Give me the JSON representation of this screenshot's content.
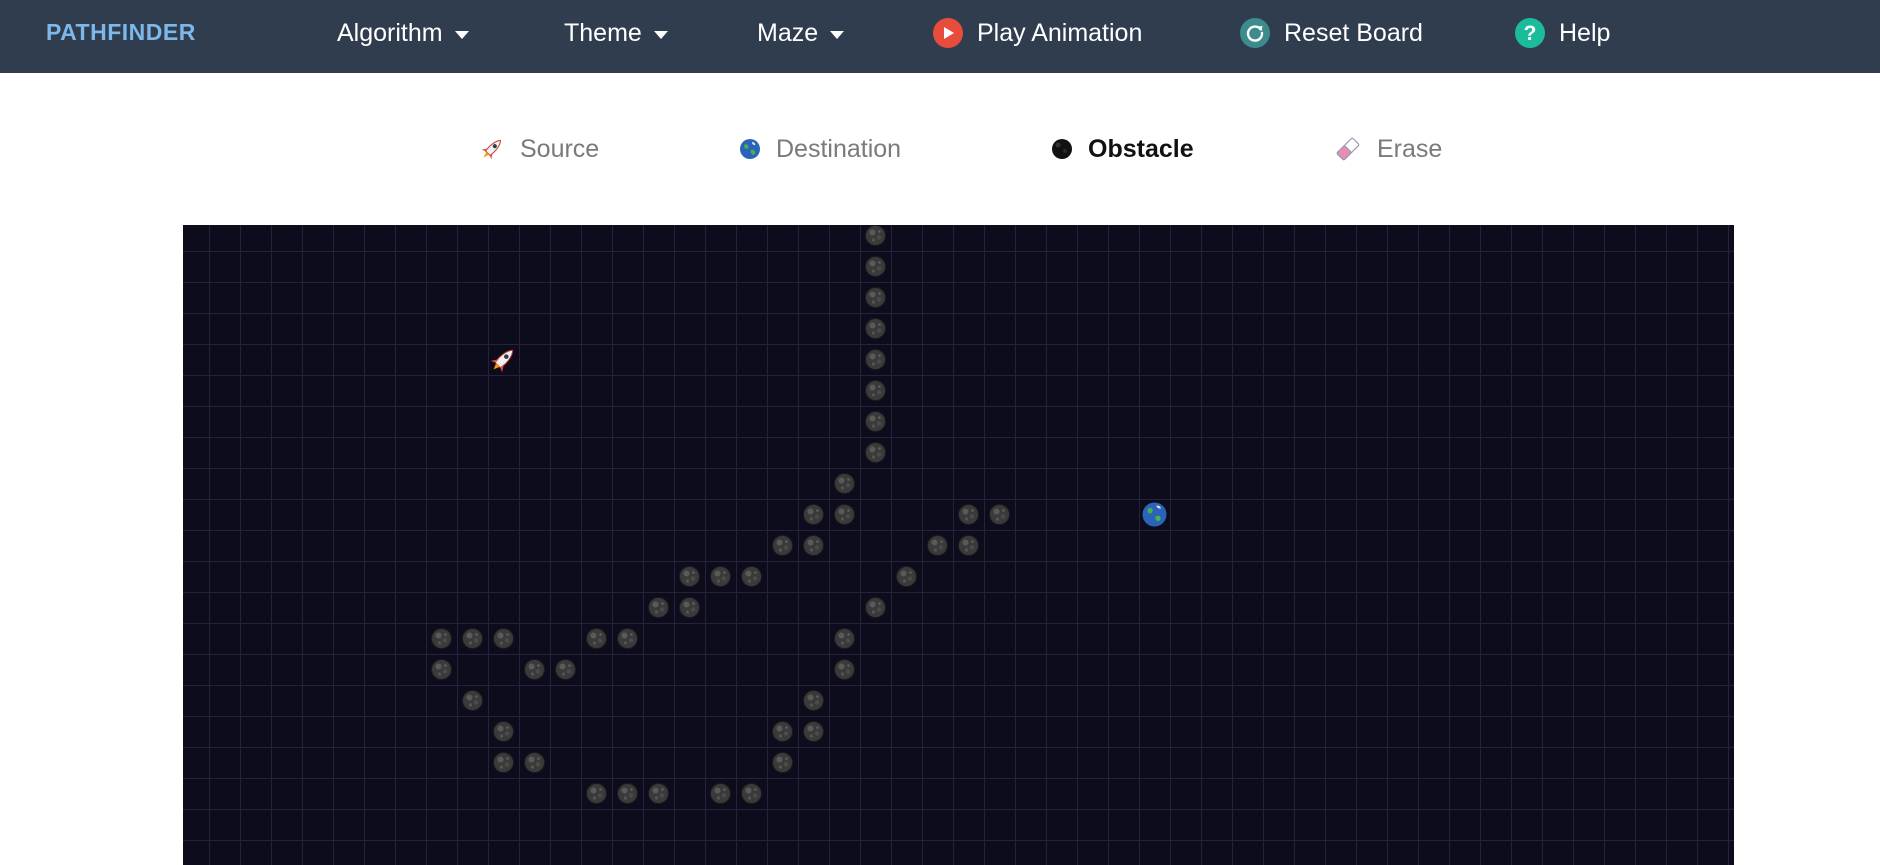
{
  "nav": {
    "brand": "PATHFINDER",
    "algorithm_label": "Algorithm",
    "theme_label": "Theme",
    "maze_label": "Maze",
    "play_label": "Play Animation",
    "reset_label": "Reset Board",
    "help_label": "Help",
    "colors": {
      "bar": "#2f3d4f",
      "brand": "#7eb7ea",
      "play": "#e74c3c",
      "reset": "#3d8b8d",
      "help": "#1abc9c"
    }
  },
  "toolbar": {
    "source_label": "Source",
    "destination_label": "Destination",
    "obstacle_label": "Obstacle",
    "erase_label": "Erase",
    "active_tool": "Obstacle"
  },
  "board": {
    "cols": 50,
    "rows": 20,
    "source": {
      "row": 4,
      "col": 10
    },
    "destination": {
      "row": 9,
      "col": 31
    },
    "obstacles": [
      [
        0,
        22
      ],
      [
        1,
        22
      ],
      [
        2,
        22
      ],
      [
        3,
        22
      ],
      [
        4,
        22
      ],
      [
        5,
        22
      ],
      [
        6,
        22
      ],
      [
        7,
        22
      ],
      [
        8,
        21
      ],
      [
        9,
        20
      ],
      [
        9,
        21
      ],
      [
        9,
        25
      ],
      [
        9,
        26
      ],
      [
        10,
        19
      ],
      [
        10,
        20
      ],
      [
        10,
        24
      ],
      [
        10,
        25
      ],
      [
        11,
        16
      ],
      [
        11,
        17
      ],
      [
        11,
        18
      ],
      [
        11,
        23
      ],
      [
        12,
        15
      ],
      [
        12,
        16
      ],
      [
        12,
        22
      ],
      [
        13,
        8
      ],
      [
        13,
        9
      ],
      [
        13,
        10
      ],
      [
        13,
        13
      ],
      [
        13,
        14
      ],
      [
        13,
        21
      ],
      [
        14,
        8
      ],
      [
        14,
        11
      ],
      [
        14,
        12
      ],
      [
        14,
        21
      ],
      [
        15,
        9
      ],
      [
        15,
        20
      ],
      [
        16,
        10
      ],
      [
        16,
        19
      ],
      [
        16,
        20
      ],
      [
        17,
        10
      ],
      [
        17,
        11
      ],
      [
        17,
        19
      ],
      [
        18,
        13
      ],
      [
        18,
        14
      ],
      [
        18,
        15
      ],
      [
        18,
        17
      ],
      [
        18,
        18
      ]
    ]
  }
}
